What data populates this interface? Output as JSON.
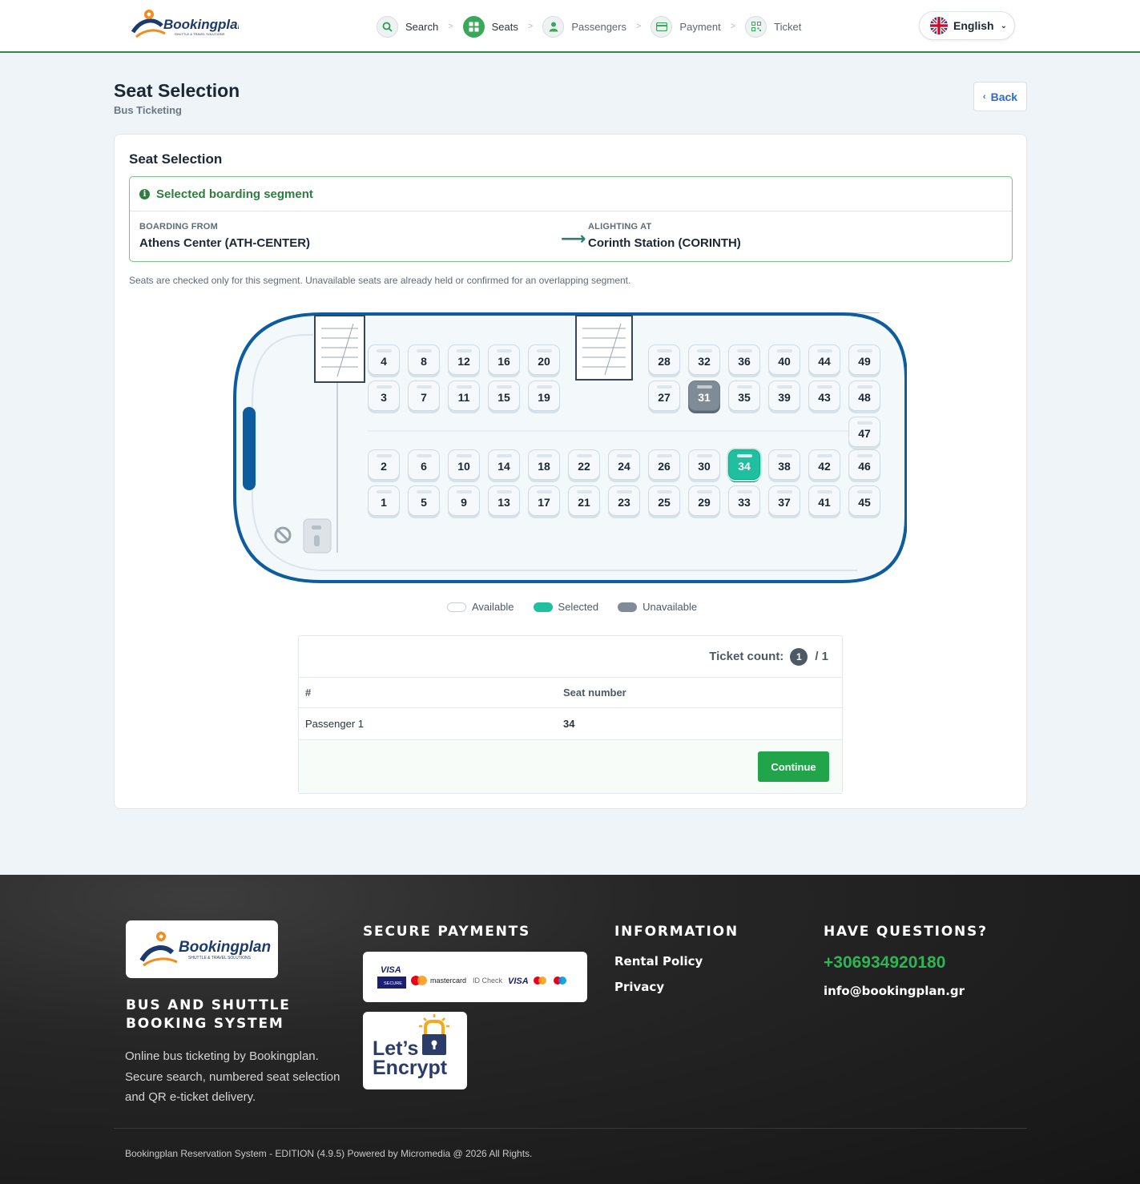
{
  "header": {
    "logo_text": "Bookingplan",
    "logo_tagline": "SHUTTLE & TRAVEL SOLUTIONS",
    "steps": [
      {
        "label": "Search",
        "icon": "search-icon",
        "state": "done"
      },
      {
        "label": "Seats",
        "icon": "seats-icon",
        "state": "active"
      },
      {
        "label": "Passengers",
        "icon": "user-icon",
        "state": "pending"
      },
      {
        "label": "Payment",
        "icon": "card-icon",
        "state": "pending"
      },
      {
        "label": "Ticket",
        "icon": "qr-icon",
        "state": "pending"
      }
    ],
    "step_separator": ">",
    "language": "English"
  },
  "page": {
    "title": "Seat Selection",
    "subtitle": "Bus Ticketing",
    "back_label": "Back"
  },
  "card": {
    "title": "Seat Selection",
    "segment": {
      "heading": "Selected boarding segment",
      "boarding_label": "BOARDING FROM",
      "boarding_value": "Athens Center (ATH-CENTER)",
      "alighting_label": "ALIGHTING AT",
      "alighting_value": "Corinth Station (CORINTH)"
    },
    "note": "Seats are checked only for this segment. Unavailable seats are already held or confirmed for an overlapping segment."
  },
  "seat_map": {
    "selected": [
      "34"
    ],
    "unavailable": [
      "31"
    ],
    "rows": [
      [
        "4",
        "8",
        "12",
        "16",
        "20",
        "",
        "",
        "28",
        "32",
        "36",
        "40",
        "44",
        "49"
      ],
      [
        "3",
        "7",
        "11",
        "15",
        "19",
        "",
        "",
        "27",
        "31",
        "35",
        "39",
        "43",
        "48"
      ],
      [
        "",
        "",
        "",
        "",
        "",
        "",
        "",
        "",
        "",
        "",
        "",
        "",
        "47"
      ],
      [
        "2",
        "6",
        "10",
        "14",
        "18",
        "22",
        "24",
        "26",
        "30",
        "34",
        "38",
        "42",
        "46"
      ],
      [
        "1",
        "5",
        "9",
        "13",
        "17",
        "21",
        "23",
        "25",
        "29",
        "33",
        "37",
        "41",
        "45"
      ]
    ]
  },
  "legend": [
    {
      "label": "Available",
      "color": "#ffffff"
    },
    {
      "label": "Selected",
      "color": "#1fbf9f"
    },
    {
      "label": "Unavailable",
      "color": "#7f8c98"
    }
  ],
  "tickets": {
    "count_label": "Ticket count:",
    "count": "1",
    "total": "/ 1",
    "col_num": "#",
    "col_seat": "Seat number",
    "rows": [
      {
        "passenger": "Passenger 1",
        "seat": "34"
      }
    ],
    "continue_label": "Continue"
  },
  "footer": {
    "logo_text": "Bookingplan",
    "logo_tagline": "SHUTTLE & TRAVEL SOLUTIONS",
    "brand_heading": "BUS AND SHUTTLE BOOKING SYSTEM",
    "description": "Online bus ticketing by Bookingplan. Secure search, numbered seat selection and QR e-ticket delivery.",
    "payments_heading": "SECURE PAYMENTS",
    "payment_badges": [
      "VISA",
      "SECURE",
      "mastercard",
      "ID Check",
      "VISA"
    ],
    "letsencrypt_line1": "Let’s",
    "letsencrypt_line2": "Encrypt",
    "info_heading": "INFORMATION",
    "links": [
      "Rental Policy",
      "Privacy"
    ],
    "questions_heading": "HAVE QUESTIONS?",
    "phone": "+306934920180",
    "email": "info@bookingplan.gr",
    "copyright": "Bookingplan Reservation System - EDITION (4.9.5) Powered by Micromedia @ 2026 All Rights."
  },
  "colors": {
    "brand_green": "#22a44b",
    "selected_seat": "#1fbf9f",
    "bus_outline": "#0d5c9e",
    "link_blue": "#2c6bd0"
  }
}
